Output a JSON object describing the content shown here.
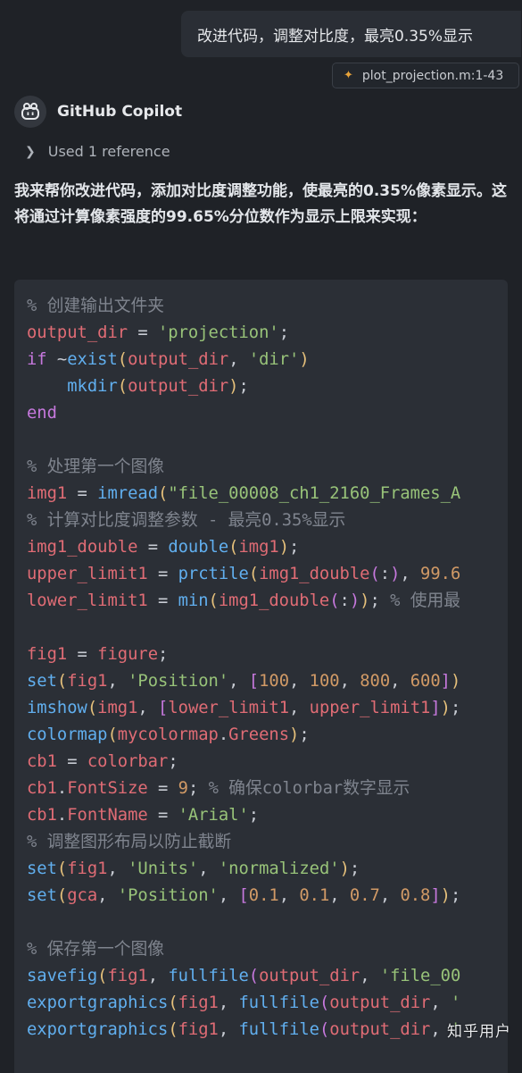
{
  "user_message": {
    "text": "改进代码，调整对比度，最亮0.35%显示",
    "reference": "plot_projection.m:1-43"
  },
  "assistant": {
    "name": "GitHub Copilot",
    "avatar_icon": "copilot-icon",
    "used_references": "Used 1 reference",
    "intro": "我来帮你改进代码，添加对比度调整功能，使最亮的0.35%像素显示。这将通过计算像素强度的99.65%分位数作为显示上限来实现："
  },
  "code_lines": [
    [
      {
        "t": "% 创建输出文件夹",
        "c": "cmt"
      }
    ],
    [
      {
        "t": "output_dir",
        "c": "var"
      },
      {
        "t": " = ",
        "c": "op"
      },
      {
        "t": "'projection'",
        "c": "str"
      },
      {
        "t": ";",
        "c": "op"
      }
    ],
    [
      {
        "t": "if",
        "c": "kw"
      },
      {
        "t": " ~",
        "c": "op"
      },
      {
        "t": "exist",
        "c": "fn"
      },
      {
        "t": "(",
        "c": "p1"
      },
      {
        "t": "output_dir",
        "c": "var"
      },
      {
        "t": ", ",
        "c": "op"
      },
      {
        "t": "'dir'",
        "c": "str"
      },
      {
        "t": ")",
        "c": "p1"
      }
    ],
    [
      {
        "t": "    ",
        "c": "op"
      },
      {
        "t": "mkdir",
        "c": "fn"
      },
      {
        "t": "(",
        "c": "p1"
      },
      {
        "t": "output_dir",
        "c": "var"
      },
      {
        "t": ")",
        "c": "p1"
      },
      {
        "t": ";",
        "c": "op"
      }
    ],
    [
      {
        "t": "end",
        "c": "kw"
      }
    ],
    [],
    [
      {
        "t": "% 处理第一个图像",
        "c": "cmt"
      }
    ],
    [
      {
        "t": "img1",
        "c": "var"
      },
      {
        "t": " = ",
        "c": "op"
      },
      {
        "t": "imread",
        "c": "fn"
      },
      {
        "t": "(",
        "c": "p1"
      },
      {
        "t": "\"file_00008_ch1_2160_Frames_A",
        "c": "str"
      }
    ],
    [
      {
        "t": "% 计算对比度调整参数 - 最亮0.35%显示",
        "c": "cmt"
      }
    ],
    [
      {
        "t": "img1_double",
        "c": "var"
      },
      {
        "t": " = ",
        "c": "op"
      },
      {
        "t": "double",
        "c": "fn"
      },
      {
        "t": "(",
        "c": "p1"
      },
      {
        "t": "img1",
        "c": "var"
      },
      {
        "t": ")",
        "c": "p1"
      },
      {
        "t": ";",
        "c": "op"
      }
    ],
    [
      {
        "t": "upper_limit1",
        "c": "var"
      },
      {
        "t": " = ",
        "c": "op"
      },
      {
        "t": "prctile",
        "c": "fn"
      },
      {
        "t": "(",
        "c": "p1"
      },
      {
        "t": "img1_double",
        "c": "var"
      },
      {
        "t": "(",
        "c": "p2"
      },
      {
        "t": ":",
        "c": "op"
      },
      {
        "t": ")",
        "c": "p2"
      },
      {
        "t": ", ",
        "c": "op"
      },
      {
        "t": "99.6",
        "c": "num"
      }
    ],
    [
      {
        "t": "lower_limit1",
        "c": "var"
      },
      {
        "t": " = ",
        "c": "op"
      },
      {
        "t": "min",
        "c": "fn"
      },
      {
        "t": "(",
        "c": "p1"
      },
      {
        "t": "img1_double",
        "c": "var"
      },
      {
        "t": "(",
        "c": "p2"
      },
      {
        "t": ":",
        "c": "op"
      },
      {
        "t": ")",
        "c": "p2"
      },
      {
        "t": ")",
        "c": "p1"
      },
      {
        "t": "; ",
        "c": "op"
      },
      {
        "t": "% 使用最",
        "c": "cmt"
      }
    ],
    [],
    [
      {
        "t": "fig1",
        "c": "var"
      },
      {
        "t": " = ",
        "c": "op"
      },
      {
        "t": "figure",
        "c": "var"
      },
      {
        "t": ";",
        "c": "op"
      }
    ],
    [
      {
        "t": "set",
        "c": "fn"
      },
      {
        "t": "(",
        "c": "p1"
      },
      {
        "t": "fig1",
        "c": "var"
      },
      {
        "t": ", ",
        "c": "op"
      },
      {
        "t": "'Position'",
        "c": "str"
      },
      {
        "t": ", ",
        "c": "op"
      },
      {
        "t": "[",
        "c": "p2"
      },
      {
        "t": "100",
        "c": "num"
      },
      {
        "t": ", ",
        "c": "op"
      },
      {
        "t": "100",
        "c": "num"
      },
      {
        "t": ", ",
        "c": "op"
      },
      {
        "t": "800",
        "c": "num"
      },
      {
        "t": ", ",
        "c": "op"
      },
      {
        "t": "600",
        "c": "num"
      },
      {
        "t": "]",
        "c": "p2"
      },
      {
        "t": ")",
        "c": "p1"
      }
    ],
    [
      {
        "t": "imshow",
        "c": "fn"
      },
      {
        "t": "(",
        "c": "p1"
      },
      {
        "t": "img1",
        "c": "var"
      },
      {
        "t": ", ",
        "c": "op"
      },
      {
        "t": "[",
        "c": "p2"
      },
      {
        "t": "lower_limit1",
        "c": "var"
      },
      {
        "t": ", ",
        "c": "op"
      },
      {
        "t": "upper_limit1",
        "c": "var"
      },
      {
        "t": "]",
        "c": "p2"
      },
      {
        "t": ")",
        "c": "p1"
      },
      {
        "t": ";",
        "c": "op"
      }
    ],
    [
      {
        "t": "colormap",
        "c": "fn"
      },
      {
        "t": "(",
        "c": "p1"
      },
      {
        "t": "mycolormap",
        "c": "var"
      },
      {
        "t": ".",
        "c": "op"
      },
      {
        "t": "Greens",
        "c": "var"
      },
      {
        "t": ")",
        "c": "p1"
      },
      {
        "t": ";",
        "c": "op"
      }
    ],
    [
      {
        "t": "cb1",
        "c": "var"
      },
      {
        "t": " = ",
        "c": "op"
      },
      {
        "t": "colorbar",
        "c": "var"
      },
      {
        "t": ";",
        "c": "op"
      }
    ],
    [
      {
        "t": "cb1",
        "c": "var"
      },
      {
        "t": ".",
        "c": "op"
      },
      {
        "t": "FontSize",
        "c": "var"
      },
      {
        "t": " = ",
        "c": "op"
      },
      {
        "t": "9",
        "c": "num"
      },
      {
        "t": "; ",
        "c": "op"
      },
      {
        "t": "% 确保colorbar数字显示",
        "c": "cmt"
      }
    ],
    [
      {
        "t": "cb1",
        "c": "var"
      },
      {
        "t": ".",
        "c": "op"
      },
      {
        "t": "FontName",
        "c": "var"
      },
      {
        "t": " = ",
        "c": "op"
      },
      {
        "t": "'Arial'",
        "c": "str"
      },
      {
        "t": ";",
        "c": "op"
      }
    ],
    [
      {
        "t": "% 调整图形布局以防止截断",
        "c": "cmt"
      }
    ],
    [
      {
        "t": "set",
        "c": "fn"
      },
      {
        "t": "(",
        "c": "p1"
      },
      {
        "t": "fig1",
        "c": "var"
      },
      {
        "t": ", ",
        "c": "op"
      },
      {
        "t": "'Units'",
        "c": "str"
      },
      {
        "t": ", ",
        "c": "op"
      },
      {
        "t": "'normalized'",
        "c": "str"
      },
      {
        "t": ")",
        "c": "p1"
      },
      {
        "t": ";",
        "c": "op"
      }
    ],
    [
      {
        "t": "set",
        "c": "fn"
      },
      {
        "t": "(",
        "c": "p1"
      },
      {
        "t": "gca",
        "c": "var"
      },
      {
        "t": ", ",
        "c": "op"
      },
      {
        "t": "'Position'",
        "c": "str"
      },
      {
        "t": ", ",
        "c": "op"
      },
      {
        "t": "[",
        "c": "p2"
      },
      {
        "t": "0.1",
        "c": "num"
      },
      {
        "t": ", ",
        "c": "op"
      },
      {
        "t": "0.1",
        "c": "num"
      },
      {
        "t": ", ",
        "c": "op"
      },
      {
        "t": "0.7",
        "c": "num"
      },
      {
        "t": ", ",
        "c": "op"
      },
      {
        "t": "0.8",
        "c": "num"
      },
      {
        "t": "]",
        "c": "p2"
      },
      {
        "t": ")",
        "c": "p1"
      },
      {
        "t": ";",
        "c": "op"
      }
    ],
    [],
    [
      {
        "t": "% 保存第一个图像",
        "c": "cmt"
      }
    ],
    [
      {
        "t": "savefig",
        "c": "fn"
      },
      {
        "t": "(",
        "c": "p1"
      },
      {
        "t": "fig1",
        "c": "var"
      },
      {
        "t": ", ",
        "c": "op"
      },
      {
        "t": "fullfile",
        "c": "fn"
      },
      {
        "t": "(",
        "c": "p2"
      },
      {
        "t": "output_dir",
        "c": "var"
      },
      {
        "t": ", ",
        "c": "op"
      },
      {
        "t": "'file_00",
        "c": "str"
      }
    ],
    [
      {
        "t": "exportgraphics",
        "c": "fn"
      },
      {
        "t": "(",
        "c": "p1"
      },
      {
        "t": "fig1",
        "c": "var"
      },
      {
        "t": ", ",
        "c": "op"
      },
      {
        "t": "fullfile",
        "c": "fn"
      },
      {
        "t": "(",
        "c": "p2"
      },
      {
        "t": "output_dir",
        "c": "var"
      },
      {
        "t": ", ",
        "c": "op"
      },
      {
        "t": "'",
        "c": "str"
      }
    ],
    [
      {
        "t": "exportgraphics",
        "c": "fn"
      },
      {
        "t": "(",
        "c": "p1"
      },
      {
        "t": "fig1",
        "c": "var"
      },
      {
        "t": ", ",
        "c": "op"
      },
      {
        "t": "fullfile",
        "c": "fn"
      },
      {
        "t": "(",
        "c": "p2"
      },
      {
        "t": "output_dir",
        "c": "var"
      },
      {
        "t": ", ",
        "c": "op"
      },
      {
        "t": "'",
        "c": "str"
      }
    ]
  ],
  "watermark": "知乎用户"
}
